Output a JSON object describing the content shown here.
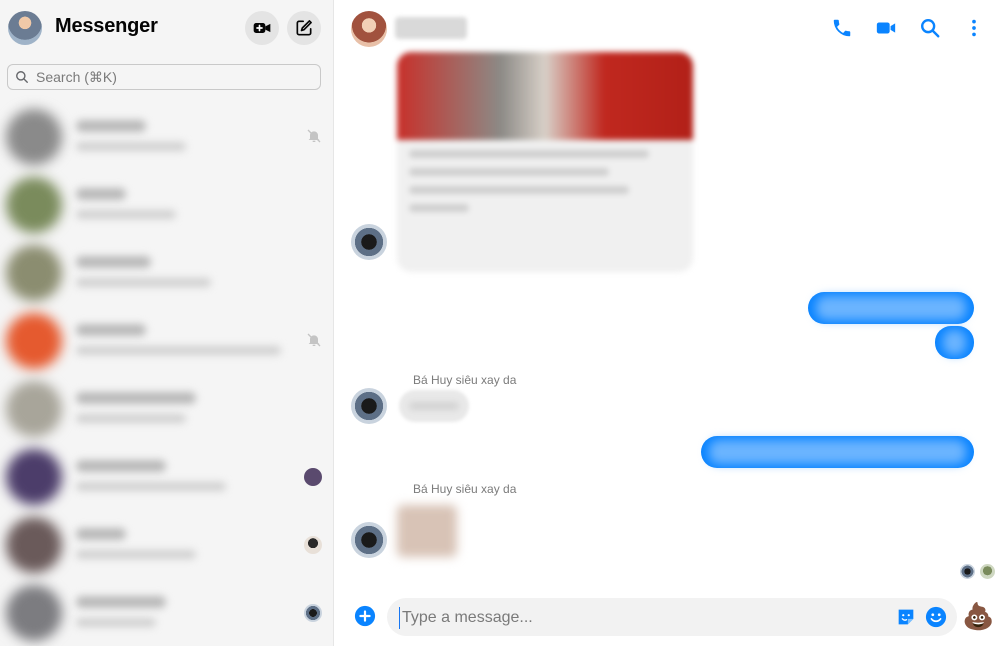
{
  "sidebar": {
    "title": "Messenger",
    "search": {
      "placeholder": "Search (⌘K)"
    },
    "conversations": [
      {
        "muted": true
      },
      {
        "muted": false
      },
      {
        "muted": false
      },
      {
        "muted": true
      },
      {
        "muted": false
      },
      {
        "muted": false
      },
      {
        "muted": false
      },
      {
        "muted": false
      }
    ]
  },
  "chat": {
    "messages": [
      {
        "sender": "Bá Huy siêu xay da"
      },
      {
        "sender": "Bá Huy siêu xay da"
      }
    ],
    "composer": {
      "placeholder": "Type a message...",
      "quick_reaction": "💩"
    }
  },
  "colors": {
    "accent": "#0a84ff",
    "sidebar_bg": "#f5f5f5"
  }
}
